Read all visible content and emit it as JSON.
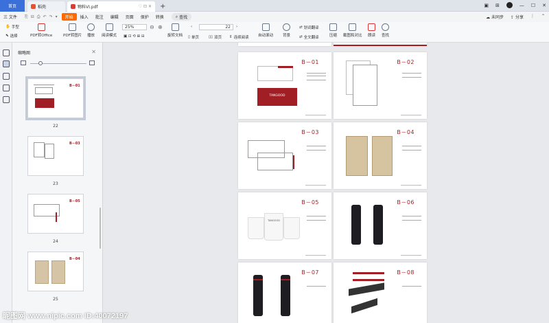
{
  "tabs": {
    "home": "首页",
    "second": "稻壳",
    "doc": "物料VI.pdf",
    "plus": "+"
  },
  "window": {
    "sync": "未同步",
    "share": "分享"
  },
  "menu": {
    "file": "三 文件",
    "items": [
      "开始",
      "插入",
      "批注",
      "编辑",
      "页面",
      "保护",
      "转换"
    ],
    "search": "查找"
  },
  "ribbon": {
    "hand": "手型",
    "select": "选择",
    "pdf_office": "PDF转Office",
    "pdf_image": "PDF转图片",
    "play": "播放",
    "read_mode": "阅读模式",
    "zoom": "25%",
    "rotate": "旋转文档",
    "single": "单页",
    "double": "双页",
    "continuous": "连续阅读",
    "auto_scroll": "自动滚动",
    "page_value": "22",
    "background": "背景",
    "translate": "划词翻译",
    "full_translate": "全文翻译",
    "compress": "压缩",
    "screenshot": "截图和对比",
    "tts": "朗读",
    "find": "查找"
  },
  "thumbnail_panel": {
    "title": "缩略图",
    "pages": [
      "22",
      "23",
      "24",
      "25"
    ]
  },
  "pages": {
    "codes": [
      "B－01",
      "B－02",
      "B－03",
      "B－04",
      "B－05",
      "B－06",
      "B－07",
      "B－08"
    ],
    "brand": "TANGOOD"
  },
  "watermark": "昵图网 www.nipic.com  ID:40072197",
  "colors": {
    "accent_red": "#a11e24",
    "tab_blue": "#3b6fd9",
    "menu_orange": "#ff6a00"
  }
}
